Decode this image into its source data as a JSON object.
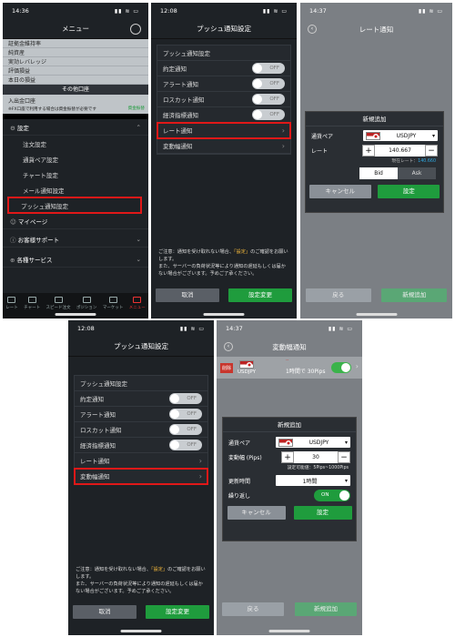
{
  "menu": {
    "time": "14:36",
    "title": "メニュー",
    "stats": [
      "証拠金維持率",
      "純資産",
      "実効レバレッジ",
      "評価損益",
      "本日の損益"
    ],
    "other_section": "その他口座",
    "deposit": "入出金口座",
    "deposit_note": "※FX口座で利用する場合は資金振替が必要です",
    "deposit_side": "資金振替",
    "settings": "設定",
    "items": [
      "注文設定",
      "通貨ペア設定",
      "チャート設定",
      "メール通知設定",
      "プッシュ通知設定"
    ],
    "mypage": "マイページ",
    "support": "お客様サポート",
    "services": "各種サービス",
    "tabs": [
      "レート",
      "チャート",
      "スピード注文",
      "ポジション",
      "マーケット",
      "メニュー"
    ]
  },
  "push1": {
    "time": "12:08",
    "title": "プッシュ通知設定",
    "section": "プッシュ通知設定",
    "rows": [
      {
        "label": "約定通知",
        "state": "OFF"
      },
      {
        "label": "アラート通知",
        "state": "OFF"
      },
      {
        "label": "ロスカット通知",
        "state": "OFF"
      },
      {
        "label": "経済指標通知",
        "state": "OFF"
      }
    ],
    "rate": "レート通知",
    "vol": "変動幅通知",
    "note1": "ご注意：通知を受け取れない場合、",
    "note_hl": "「設定」",
    "note2": "のご確認をお願いします。",
    "note3": "また、サーバーの負荷状況等により通知の遅延もしくは届かない場合がございます。予めご了承ください。",
    "cancel": "取消",
    "save": "設定変更"
  },
  "rate": {
    "time": "14:37",
    "title": "レート通知",
    "dlg_title": "新規追加",
    "pair_label": "通貨ペア",
    "pair": "USDJPY",
    "rate_label": "レート",
    "rate_value": "140.667",
    "current_label": "現在レート：",
    "current": "140.660",
    "bid": "Bid",
    "ask": "Ask",
    "cancel": "キャンセル",
    "set": "設定",
    "back": "戻る",
    "add": "新規追加"
  },
  "push2": {
    "time": "12:08",
    "title": "プッシュ通知設定"
  },
  "vol": {
    "time": "14:37",
    "title": "変動幅通知",
    "delete": "削除",
    "pair": "USDJPY",
    "alert_info": "1時間で 30Pips",
    "alert_top": "--",
    "dlg_title": "新規追加",
    "pair_label": "通貨ペア",
    "pips_label": "変動幅 (Pips)",
    "pips": "30",
    "range": "設定可能値：5Pips~1000Pips",
    "time_label": "更新時間",
    "time_value": "1時間",
    "repeat_label": "繰り返し",
    "repeat": "ON",
    "cancel": "キャンセル",
    "set": "設定",
    "back": "戻る",
    "add": "新規追加"
  }
}
